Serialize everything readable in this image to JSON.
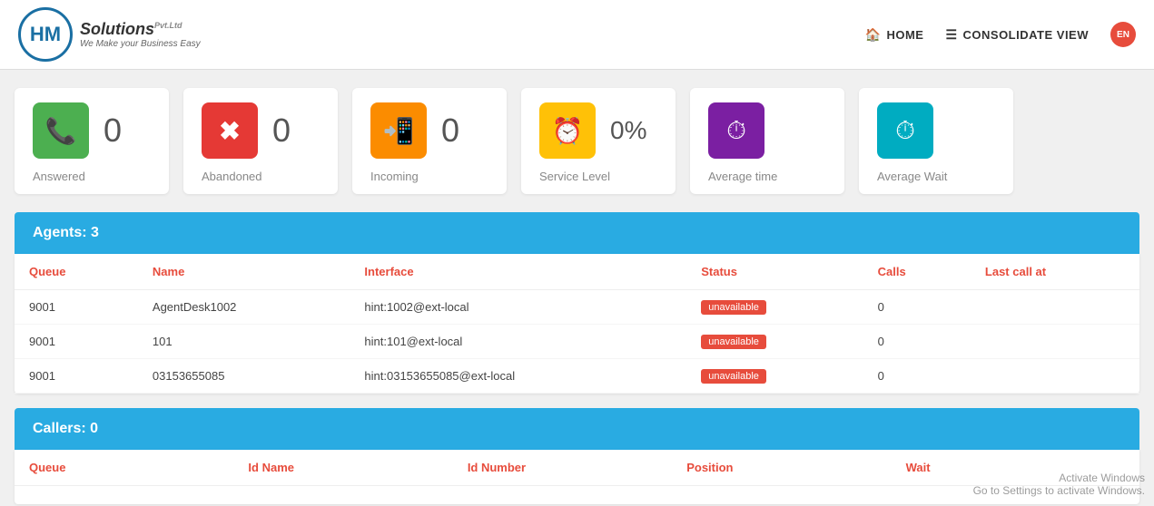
{
  "header": {
    "logo_letters": "HM",
    "logo_company": "Solutions",
    "logo_pvt": "Pvt.Ltd",
    "logo_tagline": "We Make your Business Easy",
    "nav": {
      "home_label": "HOME",
      "consolidate_label": "CONSOLIDATE VIEW",
      "lang": "EN"
    }
  },
  "stats": [
    {
      "id": "answered",
      "icon": "☎",
      "icon_class": "icon-green",
      "value": "0",
      "label": "Answered"
    },
    {
      "id": "abandoned",
      "icon": "✖",
      "icon_class": "icon-red",
      "value": "0",
      "label": "Abandoned"
    },
    {
      "id": "incoming",
      "icon": "📲",
      "icon_class": "icon-orange",
      "value": "0",
      "label": "Incoming"
    },
    {
      "id": "service-level",
      "icon": "⏱",
      "icon_class": "icon-amber",
      "value": "0%",
      "label": "Service Level"
    },
    {
      "id": "average-time",
      "icon": "⏱",
      "icon_class": "icon-purple",
      "value": "",
      "label": "Average time"
    },
    {
      "id": "average-wait",
      "icon": "⏱",
      "icon_class": "icon-teal",
      "value": "",
      "label": "Average Wait"
    }
  ],
  "agents_section": {
    "header": "Agents: 3",
    "columns": [
      "Queue",
      "Name",
      "Interface",
      "Status",
      "Calls",
      "Last call at"
    ],
    "rows": [
      {
        "queue": "9001",
        "name": "AgentDesk1002",
        "interface": "hint:1002@ext-local",
        "status": "unavailable",
        "calls": "0",
        "last_call_at": ""
      },
      {
        "queue": "9001",
        "name": "101",
        "interface": "hint:101@ext-local",
        "status": "unavailable",
        "calls": "0",
        "last_call_at": ""
      },
      {
        "queue": "9001",
        "name": "03153655085",
        "interface": "hint:03153655085@ext-local",
        "status": "unavailable",
        "calls": "0",
        "last_call_at": ""
      }
    ]
  },
  "callers_section": {
    "header": "Callers: 0",
    "columns": [
      "Queue",
      "Id Name",
      "Id Number",
      "Position",
      "Wait"
    ]
  },
  "activate_windows": {
    "line1": "Activate Windows",
    "line2": "Go to Settings to activate Windows."
  }
}
